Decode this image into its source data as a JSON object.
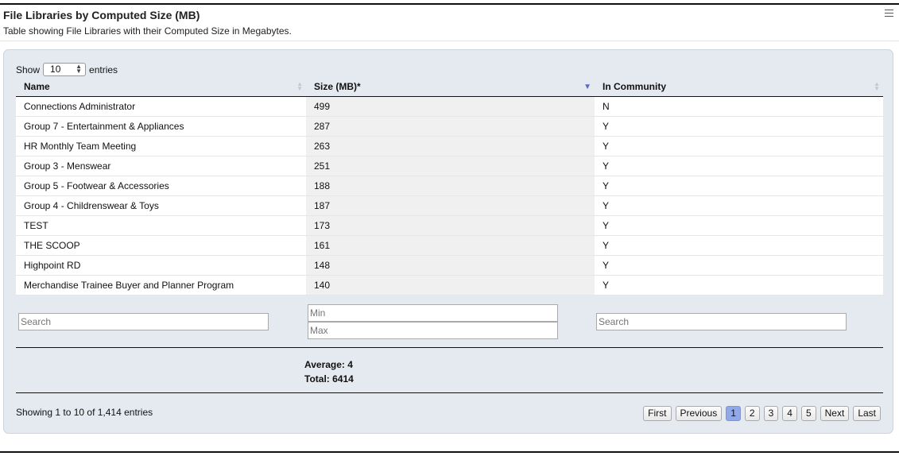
{
  "header": {
    "title": "File Libraries by Computed Size (MB)",
    "subtitle": "Table showing File Libraries with their Computed Size in Megabytes."
  },
  "length": {
    "show_label": "Show",
    "value": "10",
    "entries_label": "entries"
  },
  "columns": [
    "Name",
    "Size (MB)*",
    "In Community"
  ],
  "rows": [
    [
      "Connections Administrator",
      "499",
      "N"
    ],
    [
      "Group 7 - Entertainment & Appliances",
      "287",
      "Y"
    ],
    [
      "HR Monthly Team Meeting",
      "263",
      "Y"
    ],
    [
      "Group 3 - Menswear",
      "251",
      "Y"
    ],
    [
      "Group 5 - Footwear & Accessories",
      "188",
      "Y"
    ],
    [
      "Group 4 - Childrenswear & Toys",
      "187",
      "Y"
    ],
    [
      "TEST",
      "173",
      "Y"
    ],
    [
      "THE SCOOP",
      "161",
      "Y"
    ],
    [
      "Highpoint RD",
      "148",
      "Y"
    ],
    [
      "Merchandise Trainee Buyer and Planner Program",
      "140",
      "Y"
    ]
  ],
  "filters": {
    "name_placeholder": "Search",
    "min_placeholder": "Min",
    "max_placeholder": "Max",
    "community_placeholder": "Search"
  },
  "stats": {
    "average": "Average: 4",
    "total": "Total: 6414"
  },
  "info": "Showing 1 to 10 of 1,414 entries",
  "pagination": {
    "first": "First",
    "previous": "Previous",
    "pages": [
      "1",
      "2",
      "3",
      "4",
      "5"
    ],
    "current": "1",
    "next": "Next",
    "last": "Last"
  },
  "colors": {
    "panel": "#e5eaf1",
    "current_page": "#8fa8e8",
    "sort_active": "#5a6bbd"
  }
}
